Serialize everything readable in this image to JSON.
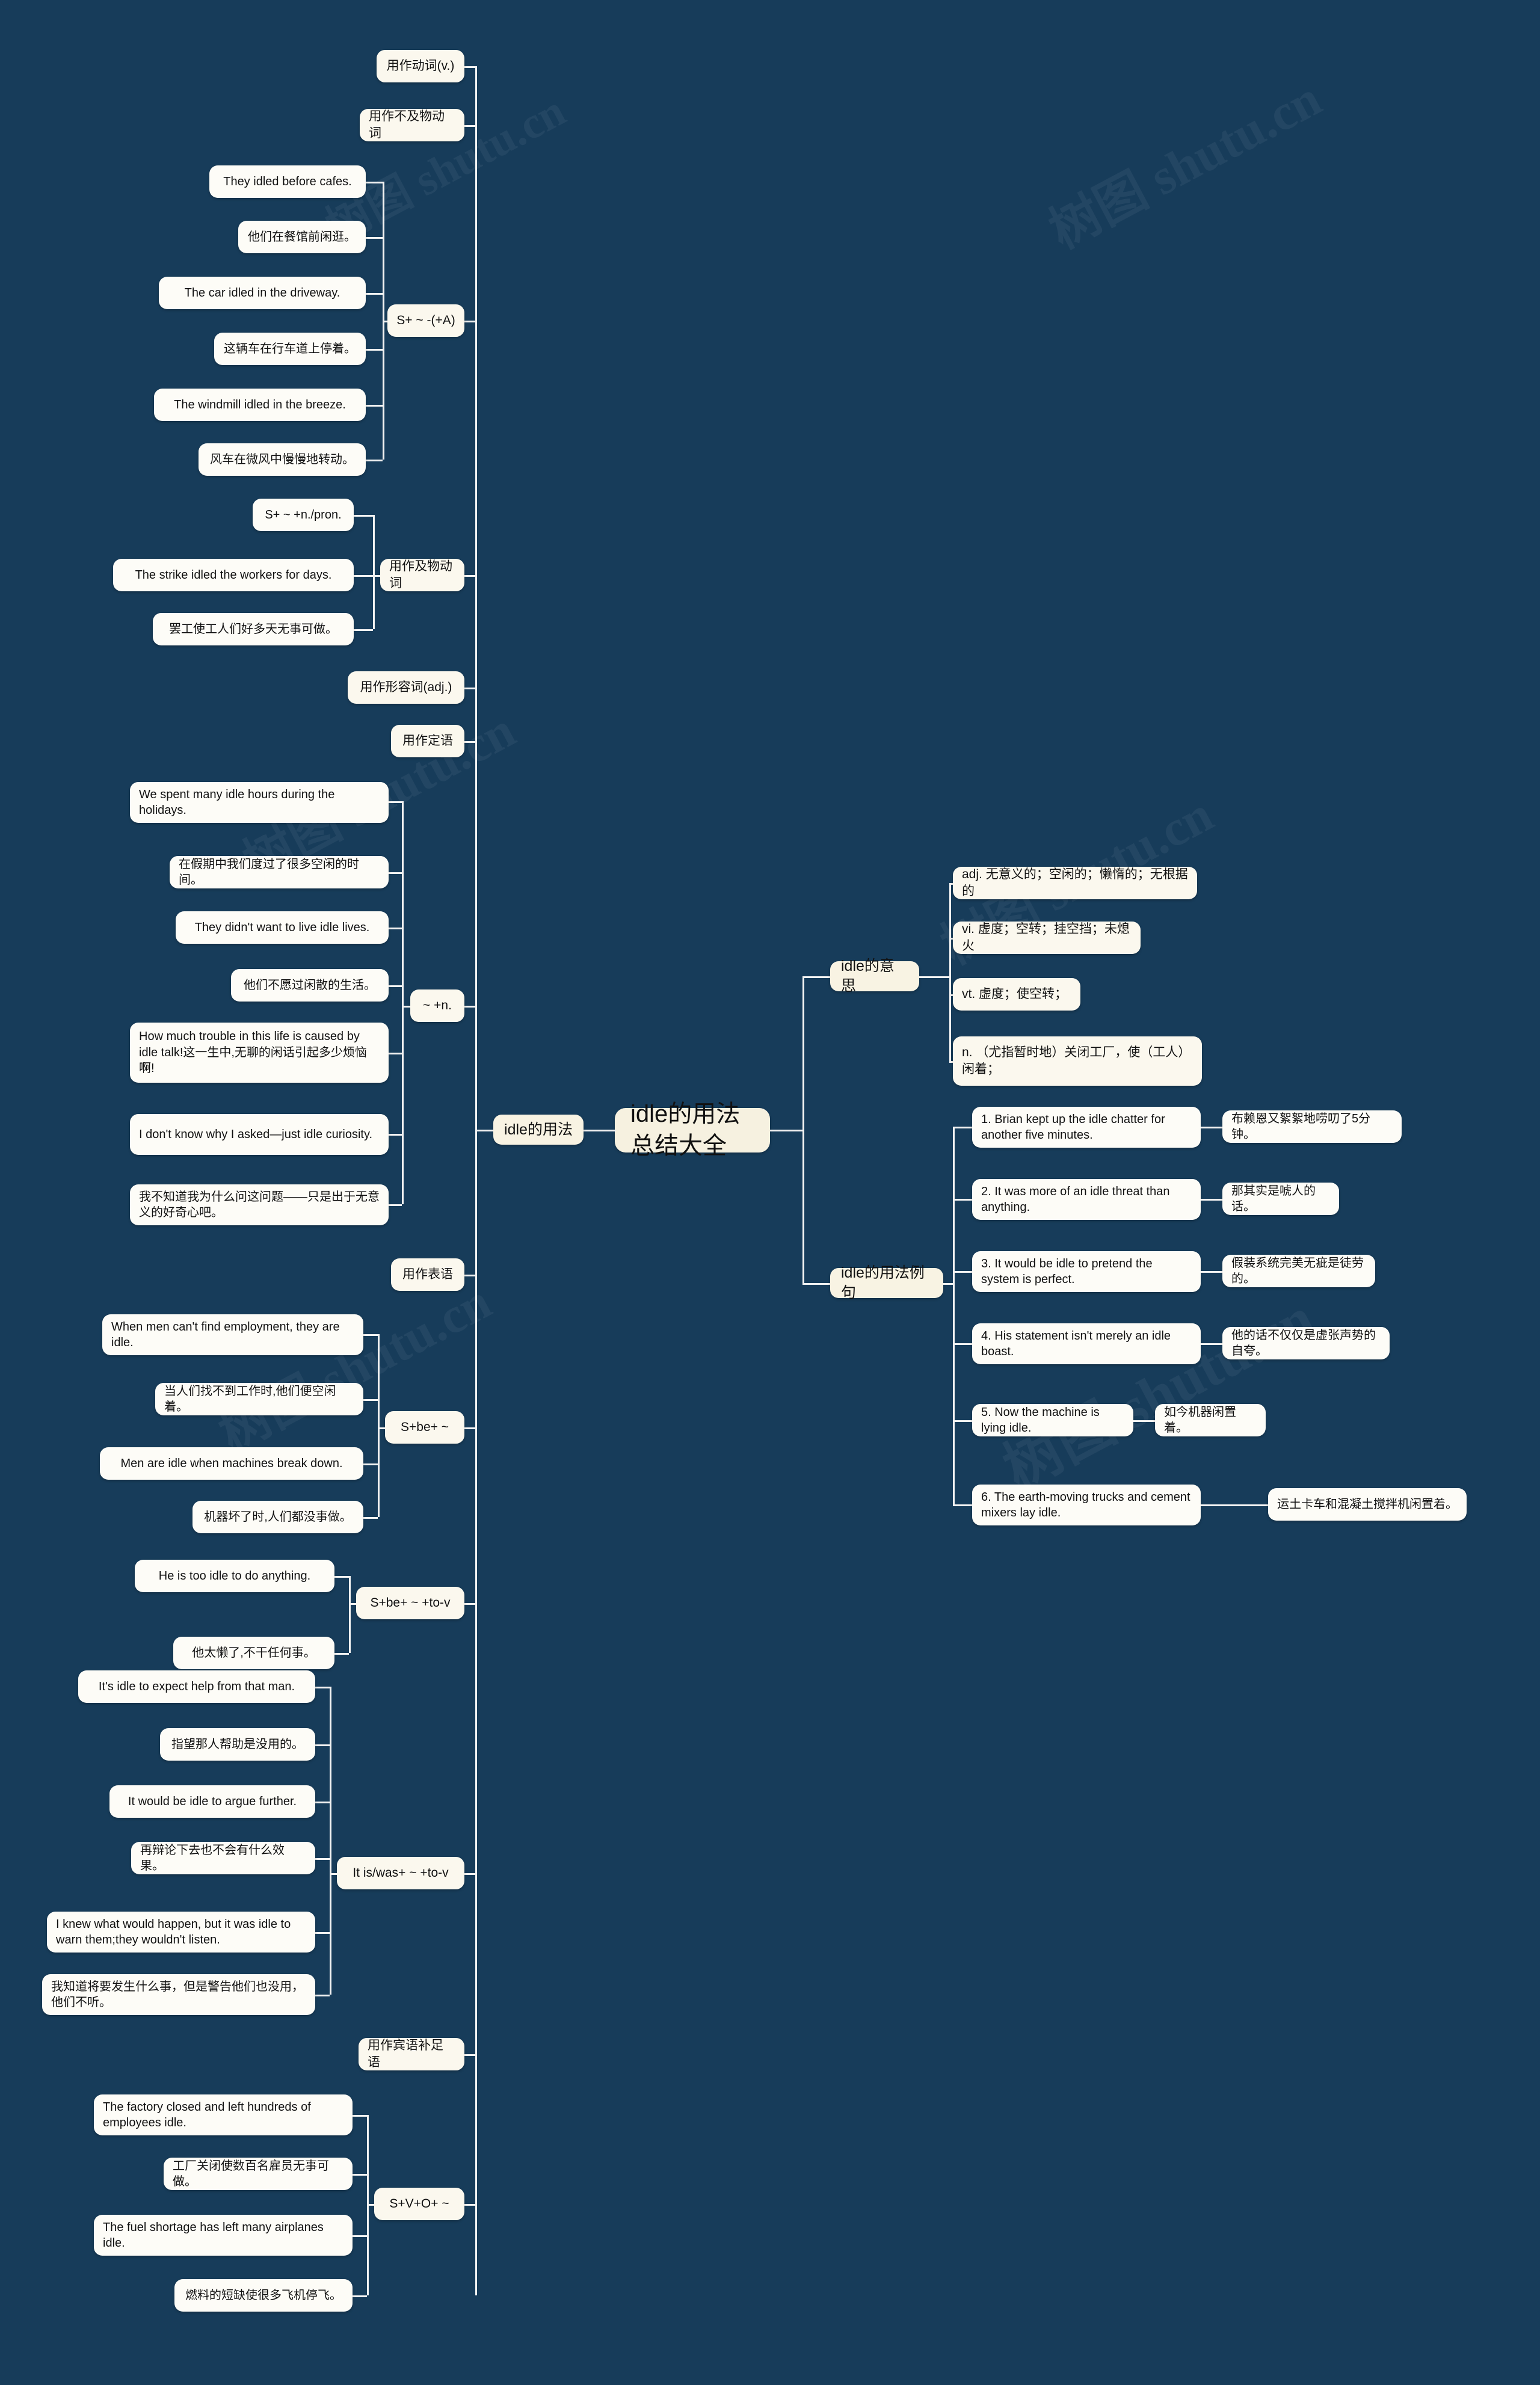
{
  "background_color": "#173c5a",
  "node_color": "#fbf8ee",
  "line_color": "#f2f2f2",
  "watermarks": [
    "树图 shutu.cn",
    "树图 shutu.cn",
    "树图 shutu.cn",
    "树图 shutu.cn",
    "树图 shutu.cn",
    "树图 shutu.cn"
  ],
  "root": {
    "label": "idle的用法总结大全"
  },
  "branches": {
    "usage": {
      "label": "idle的用法"
    },
    "meaning": {
      "label": "idle的意思"
    },
    "examples": {
      "label": "idle的用法例句"
    }
  },
  "meaning_items": [
    {
      "label": "adj. 无意义的；空闲的；懒惰的；无根据的"
    },
    {
      "label": "vi. 虚度；空转；挂空挡；未熄火"
    },
    {
      "label": "vt. 虚度；使空转；"
    },
    {
      "label": "n. （尤指暂时地）关闭工厂，使（工人）闲着；"
    }
  ],
  "example_items": [
    {
      "en": "1. Brian kept up the idle chatter for another five minutes.",
      "zh": "布赖恩又絮絮地唠叨了5分钟。"
    },
    {
      "en": "2. It was more of an idle threat than anything.",
      "zh": "那其实是唬人的话。"
    },
    {
      "en": "3. It would be idle to pretend the system is perfect.",
      "zh": "假装系统完美无疵是徒劳的。"
    },
    {
      "en": "4. His statement isn't merely an idle boast.",
      "zh": "他的话不仅仅是虚张声势的自夸。"
    },
    {
      "en": "5. Now the machine is lying idle.",
      "zh": "如今机器闲置着。"
    },
    {
      "en": "6. The earth-moving trucks and cement mixers lay idle.",
      "zh": "运土卡车和混凝土搅拌机闲置着。"
    }
  ],
  "usage_nodes": {
    "verb": "用作动词(v.)",
    "intransitive": "用作不及物动词",
    "pattern_sa": "S+ ~ -(+A)",
    "pattern_snpron": "S+ ~ +n./pron.",
    "transitive": "用作及物动词",
    "adjective": "用作形容词(adj.)",
    "attributive": "用作定语",
    "pattern_n": "~ +n.",
    "predicative": "用作表语",
    "pattern_sbe": "S+be+ ~",
    "pattern_sbetov": "S+be+ ~ +to-v",
    "pattern_itwas": "It is/was+ ~ +to-v",
    "object_complement": "用作宾语补足语",
    "pattern_svo": "S+V+O+ ~"
  },
  "sentences": {
    "sa": [
      "They idled before cafes.",
      "他们在餐馆前闲逛。",
      "The car idled in the driveway.",
      "这辆车在行车道上停着。",
      "The windmill idled in the breeze.",
      "风车在微风中慢慢地转动。"
    ],
    "snpron": [
      "The strike idled the workers for days.",
      "罢工使工人们好多天无事可做。"
    ],
    "attr_n": [
      "We spent many idle hours during the holidays.",
      "在假期中我们度过了很多空闲的时间。",
      "They didn't want to live idle lives.",
      "他们不愿过闲散的生活。",
      "How much trouble in this life is caused by idle talk!这一生中,无聊的闲话引起多少烦恼啊!",
      "I don't know why I asked—just idle curiosity.",
      "我不知道我为什么问这问题——只是出于无意义的好奇心吧。"
    ],
    "sbe": [
      "When men can't find employment, they are idle.",
      "当人们找不到工作时,他们便空闲着。",
      "Men are idle when machines break down.",
      "机器坏了时,人们都没事做。"
    ],
    "sbetov": [
      "He is too idle to do anything.",
      "他太懒了,不干任何事。"
    ],
    "itwas": [
      "It's idle to expect help from that man.",
      "指望那人帮助是没用的。",
      "It would be idle to argue further.",
      "再辩论下去也不会有什么效果。",
      "I knew what would happen, but it was idle to warn them;they wouldn't listen.",
      "我知道将要发生什么事，但是警告他们也没用，他们不听。"
    ],
    "svo": [
      "The factory closed and left hundreds of employees idle.",
      "工厂关闭使数百名雇员无事可做。",
      "The fuel shortage has left many airplanes idle.",
      "燃料的短缺使很多飞机停飞。"
    ]
  }
}
